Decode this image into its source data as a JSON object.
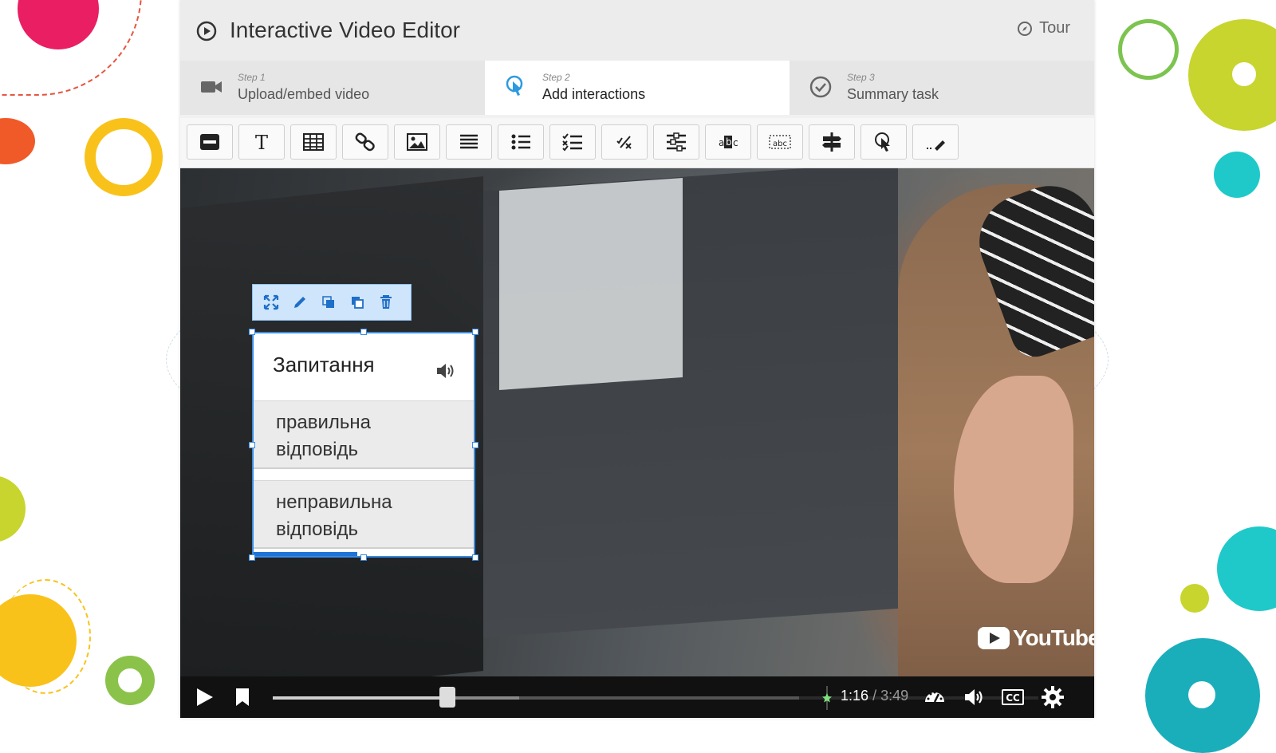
{
  "app": {
    "title": "Interactive Video Editor",
    "tour_label": "Tour"
  },
  "steps": [
    {
      "small": "Step 1",
      "label": "Upload/embed video",
      "icon": "video-camera-icon",
      "active": false
    },
    {
      "small": "Step 2",
      "label": "Add interactions",
      "icon": "touch-pointer-icon",
      "active": true
    },
    {
      "small": "Step 3",
      "label": "Summary task",
      "icon": "check-circle-icon",
      "active": false
    }
  ],
  "toolbar": {
    "buttons": [
      "label-icon",
      "text-icon",
      "table-icon",
      "link-icon",
      "image-icon",
      "statements-icon",
      "single-choice-icon",
      "multiple-choice-icon",
      "true-false-icon",
      "drag-text-icon",
      "fill-blanks-icon",
      "mark-words-icon",
      "crossroads-icon",
      "hotspot-icon",
      "free-text-icon"
    ]
  },
  "interaction": {
    "toolbar_icons": [
      "fullscreen-icon",
      "edit-icon",
      "bring-front-icon",
      "send-back-icon",
      "delete-icon"
    ],
    "question": "Запитання",
    "answers": [
      {
        "text": "правильна відповідь"
      },
      {
        "text": "неправильна відповідь"
      }
    ]
  },
  "player": {
    "brand": "YouTube",
    "current_time": "1:16",
    "separator": "/",
    "duration": "3:49",
    "progress_fraction": 0.332
  },
  "colors": {
    "accent": "#1e74d8",
    "popup_border": "#3a8be0"
  }
}
